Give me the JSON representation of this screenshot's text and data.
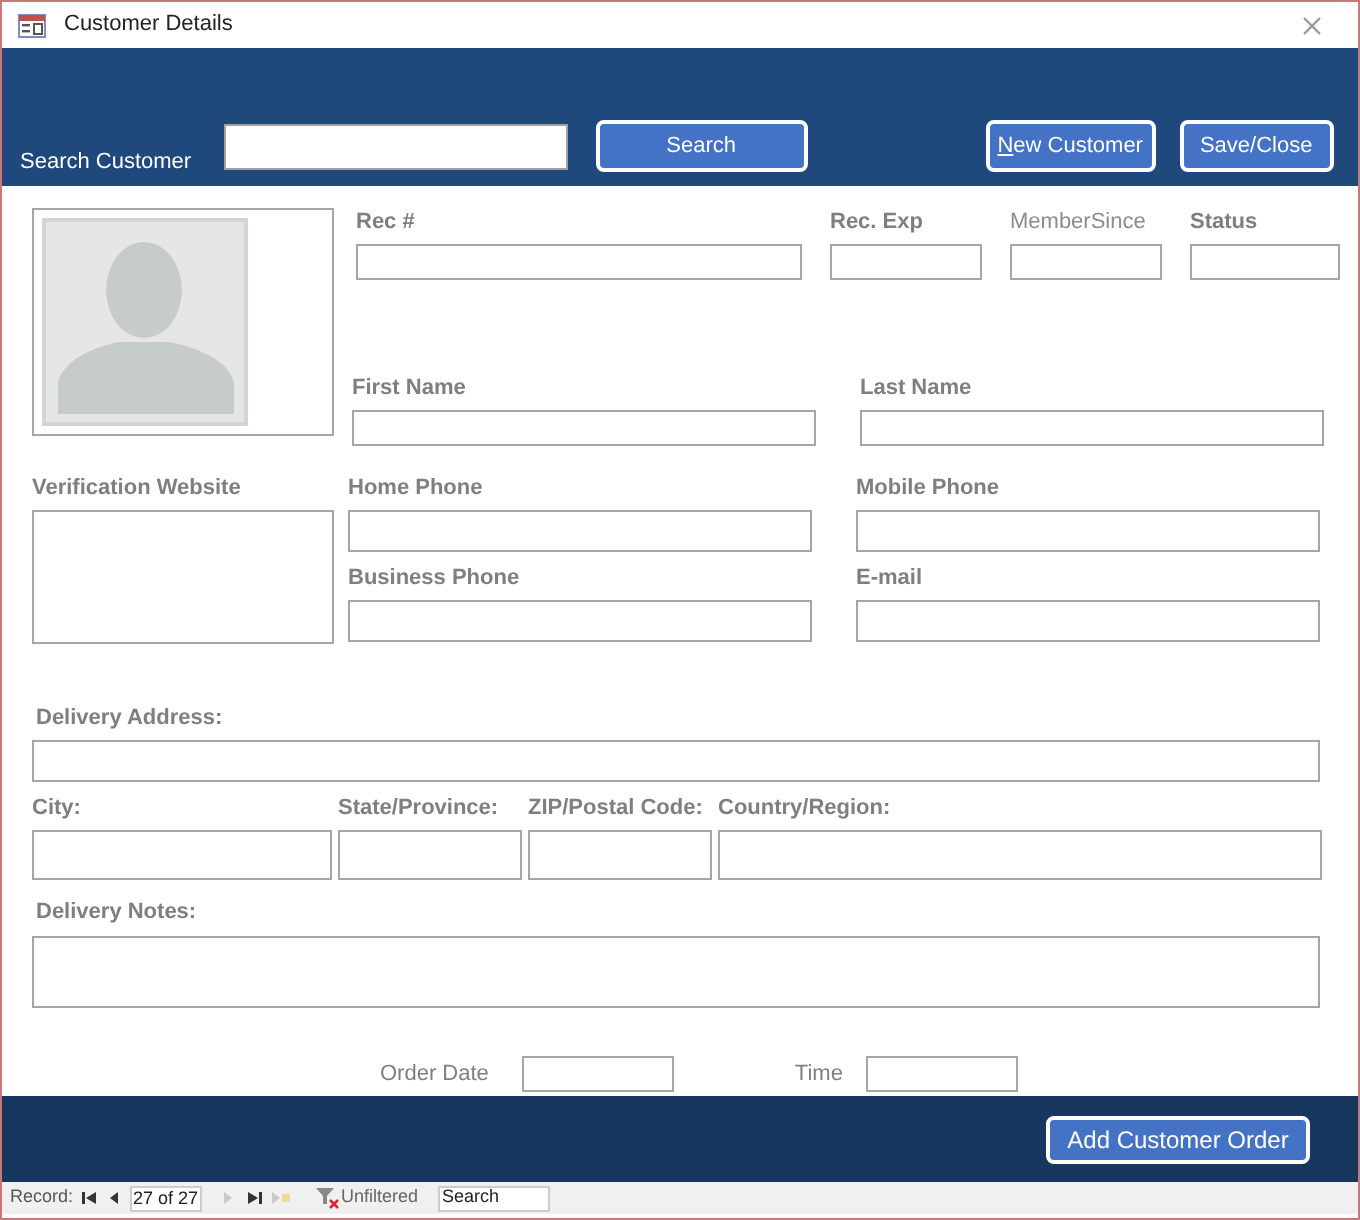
{
  "window": {
    "title": "Customer Details"
  },
  "header": {
    "search_label": "Search Customer",
    "buttons": [
      {
        "label": "Search",
        "underline_first": false
      },
      {
        "label": "New Customer",
        "underline_first": true
      },
      {
        "label": "Save/Close",
        "underline_first": false
      }
    ]
  },
  "top_fields": [
    {
      "label": "Rec #",
      "bold": true
    },
    {
      "label": "Rec. Exp",
      "bold": true
    },
    {
      "label": "MemberSince",
      "bold": false
    },
    {
      "label": "Status",
      "bold": true
    }
  ],
  "name_fields": [
    {
      "label": "First Name"
    },
    {
      "label": "Last Name"
    }
  ],
  "verification": {
    "label": "Verification Website"
  },
  "phone_fields": [
    {
      "label": "Home Phone"
    },
    {
      "label": "Mobile Phone"
    },
    {
      "label": "Business Phone"
    },
    {
      "label": "E-mail"
    }
  ],
  "delivery_address": {
    "label": "Delivery Address:"
  },
  "location_fields": [
    {
      "label": "City:"
    },
    {
      "label": "State/Province:"
    },
    {
      "label": "ZIP/Postal Code:"
    },
    {
      "label": "Country/Region:"
    }
  ],
  "delivery_notes": {
    "label": "Delivery Notes:"
  },
  "order_fields": [
    {
      "label": "Order Date"
    },
    {
      "label": "Time"
    }
  ],
  "footer": {
    "button": "Add Customer Order"
  },
  "navigation": {
    "record_label": "Record:",
    "nav_buttons": [
      {
        "kind": "first",
        "disabled": false
      },
      {
        "kind": "prev",
        "disabled": false
      }
    ],
    "position": "27 of 27",
    "nav_buttons_after": [
      {
        "kind": "next",
        "disabled": true
      },
      {
        "kind": "last",
        "disabled": false
      },
      {
        "kind": "new",
        "disabled": true
      }
    ],
    "filter": "Unfiltered",
    "search_placeholder": "Search"
  }
}
